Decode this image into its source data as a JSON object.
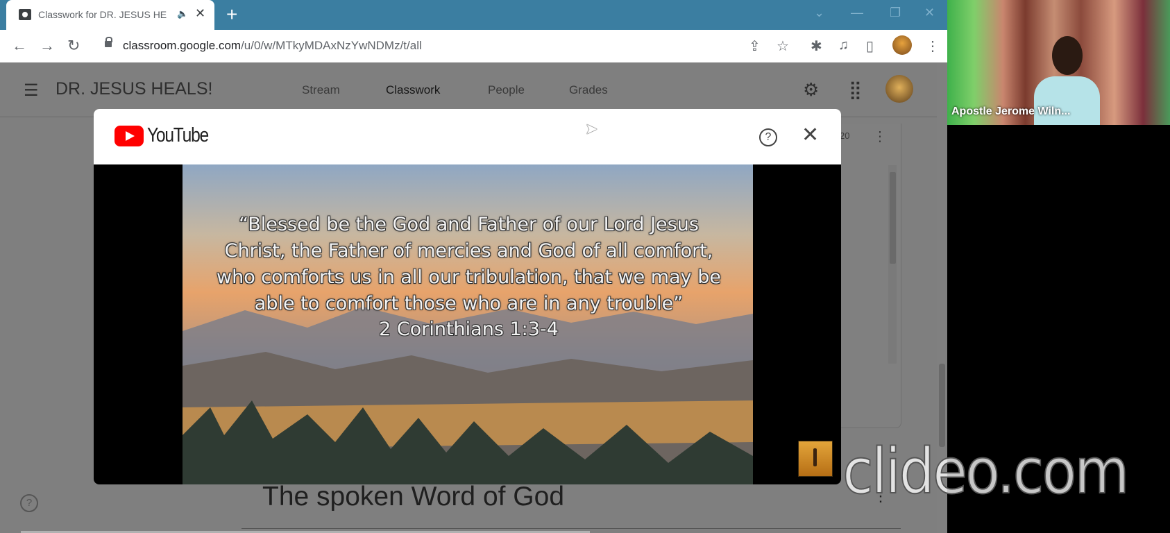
{
  "browser": {
    "tab_title": "Classwork for DR. JESUS HE",
    "tab_audio": "🔈",
    "tab_close": "✕",
    "new_tab": "+",
    "url_host": "classroom.google.com",
    "url_path": "/u/0/w/MTkyMDAxNzYwNDMz/t/all"
  },
  "classroom": {
    "menu_icon": "☰",
    "class_name": "DR. JESUS HEALS!",
    "tabs": [
      "Stream",
      "Classwork",
      "People",
      "Grades"
    ],
    "card_date": "20",
    "section_title": "The spoken Word of God"
  },
  "youtube_modal": {
    "brand": "YouTube",
    "help": "?",
    "close": "✕",
    "quote": "“Blessed be the God and Father of our Lord Jesus Christ, the Father of mercies and God of all comfort, who comforts us in all our tribulation, that we may be able to comfort those who are in any trouble”",
    "reference": "2 Corinthians 1:3-4"
  },
  "video_call": {
    "participant_name": "Apostle Jerome Wiln..."
  },
  "watermark": "clideo.com",
  "help_icon": "?",
  "colors": {
    "tabbar": "#3b7ea1",
    "youtube_red": "#ff0000",
    "overlay_gray": "#7f7f7f"
  }
}
